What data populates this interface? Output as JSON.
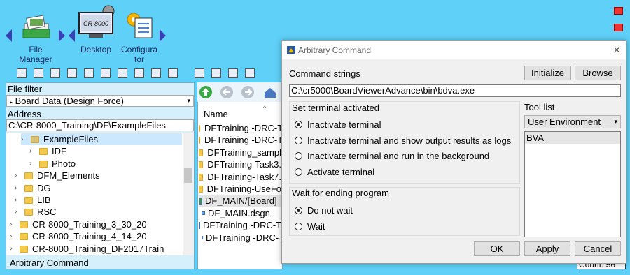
{
  "launcher": {
    "items": [
      {
        "label": "File\nManager",
        "icon": "file-manager-icon"
      },
      {
        "label": "Desktop",
        "icon": "desktop-monitor-icon",
        "badge": "CR-8000"
      },
      {
        "label": "Configura\ntor",
        "icon": "configurator-icon"
      }
    ]
  },
  "left_panel": {
    "file_filter_label": "File filter",
    "file_filter_value": "Board Data (Design Force)",
    "address_label": "Address",
    "address_value": "C:\\CR-8000_Training\\DF\\ExampleFiles",
    "tree": [
      {
        "label": "ExampleFiles",
        "level": 2,
        "selected": true
      },
      {
        "label": "IDF",
        "level": 3
      },
      {
        "label": "Photo",
        "level": 3
      },
      {
        "label": "DFM_Elements",
        "level": 2
      },
      {
        "label": "DG",
        "level": 2
      },
      {
        "label": "LIB",
        "level": 2
      },
      {
        "label": "RSC",
        "level": 2
      },
      {
        "label": "CR-8000_Training_3_30_20",
        "level": 1
      },
      {
        "label": "CR-8000_Training_4_14_20",
        "level": 1
      },
      {
        "label": "CR-8000_Training_DF2017Train",
        "level": 1
      }
    ],
    "status": "Arbitrary Command"
  },
  "file_list": {
    "column_name": "Name",
    "items": [
      {
        "label": "DFTraining -DRC-T",
        "type": "folder"
      },
      {
        "label": "DFTraining -DRC-T",
        "type": "folder"
      },
      {
        "label": "DFTraining_sampl",
        "type": "folder"
      },
      {
        "label": "DFTraining-Task3.",
        "type": "folder"
      },
      {
        "label": "DFTraining-Task7.",
        "type": "folder"
      },
      {
        "label": "DFTraining-UseFo",
        "type": "folder"
      },
      {
        "label": "DF_MAIN/[Board]",
        "type": "board"
      },
      {
        "label": "DF_MAIN.dsgn",
        "type": "file"
      },
      {
        "label": "DFTraining -DRC-Ta",
        "type": "board"
      },
      {
        "label": "DFTraining -DRC-T",
        "type": "file"
      }
    ],
    "count_label": "Count: 56"
  },
  "dialog": {
    "title": "Arbitrary Command",
    "command_strings_label": "Command strings",
    "initialize_label": "Initialize",
    "browse_label": "Browse",
    "command_value": "C:\\cr5000\\BoardViewerAdvance\\bin\\bdva.exe",
    "terminal_group_label": "Set terminal activated",
    "terminal_options": [
      {
        "label": "Inactivate terminal",
        "checked": true
      },
      {
        "label": "Inactivate terminal and show output results as logs",
        "checked": false
      },
      {
        "label": "Inactivate terminal and run in the background",
        "checked": false
      },
      {
        "label": "Activate terminal",
        "checked": false
      }
    ],
    "wait_group_label": "Wait for ending program",
    "wait_options": [
      {
        "label": "Do not wait",
        "checked": true
      },
      {
        "label": "Wait",
        "checked": false
      }
    ],
    "tool_list_label": "Tool list",
    "tool_list_select": "User Environment",
    "tool_list_items": [
      "BVA"
    ],
    "ok_label": "OK",
    "apply_label": "Apply",
    "cancel_label": "Cancel"
  }
}
